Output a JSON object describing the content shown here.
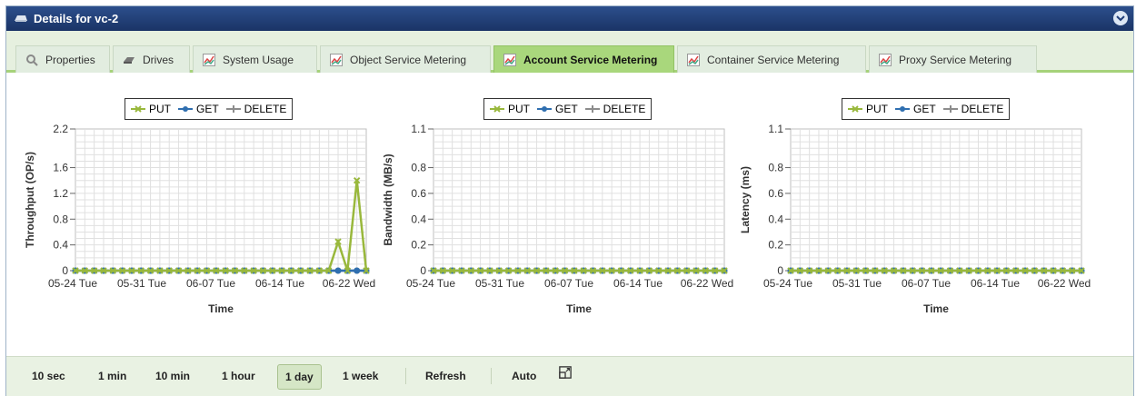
{
  "window": {
    "title": "Details for vc-2"
  },
  "tabs": [
    {
      "label": "Properties",
      "icon": "magnifier-icon"
    },
    {
      "label": "Drives",
      "icon": "drive-icon"
    },
    {
      "label": "System Usage",
      "icon": "chart-icon"
    },
    {
      "label": "Object Service Metering",
      "icon": "chart-icon"
    },
    {
      "label": "Account Service Metering",
      "icon": "chart-icon",
      "active": true
    },
    {
      "label": "Container Service Metering",
      "icon": "chart-icon"
    },
    {
      "label": "Proxy Service Metering",
      "icon": "chart-icon"
    }
  ],
  "legend": {
    "put": "PUT",
    "get": "GET",
    "delete": "DELETE"
  },
  "colors": {
    "put": "#99b83c",
    "get": "#2f6fb0",
    "delete": "#8c8c8c",
    "active_tab": "#a9d77c",
    "title_bar": "#1f3c78"
  },
  "chart_data": [
    {
      "type": "line",
      "xlabel": "Time",
      "ylabel": "Throughput (OP/s)",
      "ylim": [
        0,
        2.2
      ],
      "yticks": [
        "0",
        "0.4",
        "0.8",
        "1.2",
        "1.6",
        "2.2"
      ],
      "xticks": [
        "05-24 Tue",
        "05-31 Tue",
        "06-07 Tue",
        "06-14 Tue",
        "06-22 Wed"
      ],
      "grid": true,
      "legend_position": "top",
      "series": [
        {
          "name": "PUT",
          "values": [
            0,
            0,
            0,
            0,
            0,
            0,
            0,
            0,
            0,
            0,
            0,
            0,
            0,
            0,
            0,
            0,
            0,
            0,
            0,
            0,
            0,
            0,
            0,
            0,
            0,
            0,
            0,
            0,
            0.45,
            0,
            1.4,
            0
          ]
        },
        {
          "name": "GET",
          "values": [
            0,
            0,
            0,
            0,
            0,
            0,
            0,
            0,
            0,
            0,
            0,
            0,
            0,
            0,
            0,
            0,
            0,
            0,
            0,
            0,
            0,
            0,
            0,
            0,
            0,
            0,
            0,
            0,
            0,
            0,
            0,
            0
          ]
        },
        {
          "name": "DELETE",
          "values": [
            0,
            0,
            0,
            0,
            0,
            0,
            0,
            0,
            0,
            0,
            0,
            0,
            0,
            0,
            0,
            0,
            0,
            0,
            0,
            0,
            0,
            0,
            0,
            0,
            0,
            0,
            0,
            0,
            0,
            0,
            0,
            0
          ]
        }
      ]
    },
    {
      "type": "line",
      "xlabel": "Time",
      "ylabel": "Bandwidth (MB/s)",
      "ylim": [
        0,
        1.1
      ],
      "yticks": [
        "0",
        "0.2",
        "0.4",
        "0.6",
        "0.8",
        "1.1"
      ],
      "xticks": [
        "05-24 Tue",
        "05-31 Tue",
        "06-07 Tue",
        "06-14 Tue",
        "06-22 Wed"
      ],
      "grid": true,
      "legend_position": "top",
      "series": [
        {
          "name": "PUT",
          "values": [
            0,
            0,
            0,
            0,
            0,
            0,
            0,
            0,
            0,
            0,
            0,
            0,
            0,
            0,
            0,
            0,
            0,
            0,
            0,
            0,
            0,
            0,
            0,
            0,
            0,
            0,
            0,
            0,
            0,
            0,
            0,
            0
          ]
        },
        {
          "name": "GET",
          "values": [
            0,
            0,
            0,
            0,
            0,
            0,
            0,
            0,
            0,
            0,
            0,
            0,
            0,
            0,
            0,
            0,
            0,
            0,
            0,
            0,
            0,
            0,
            0,
            0,
            0,
            0,
            0,
            0,
            0,
            0,
            0,
            0
          ]
        },
        {
          "name": "DELETE",
          "values": [
            0,
            0,
            0,
            0,
            0,
            0,
            0,
            0,
            0,
            0,
            0,
            0,
            0,
            0,
            0,
            0,
            0,
            0,
            0,
            0,
            0,
            0,
            0,
            0,
            0,
            0,
            0,
            0,
            0,
            0,
            0,
            0
          ]
        }
      ]
    },
    {
      "type": "line",
      "xlabel": "Time",
      "ylabel": "Latency (ms)",
      "ylim": [
        0,
        1.1
      ],
      "yticks": [
        "0",
        "0.2",
        "0.4",
        "0.6",
        "0.8",
        "1.1"
      ],
      "xticks": [
        "05-24 Tue",
        "05-31 Tue",
        "06-07 Tue",
        "06-14 Tue",
        "06-22 Wed"
      ],
      "grid": true,
      "legend_position": "top",
      "series": [
        {
          "name": "PUT",
          "values": [
            0,
            0,
            0,
            0,
            0,
            0,
            0,
            0,
            0,
            0,
            0,
            0,
            0,
            0,
            0,
            0,
            0,
            0,
            0,
            0,
            0,
            0,
            0,
            0,
            0,
            0,
            0,
            0,
            0,
            0,
            0,
            0
          ]
        },
        {
          "name": "GET",
          "values": [
            0,
            0,
            0,
            0,
            0,
            0,
            0,
            0,
            0,
            0,
            0,
            0,
            0,
            0,
            0,
            0,
            0,
            0,
            0,
            0,
            0,
            0,
            0,
            0,
            0,
            0,
            0,
            0,
            0,
            0,
            0,
            0
          ]
        },
        {
          "name": "DELETE",
          "values": [
            0,
            0,
            0,
            0,
            0,
            0,
            0,
            0,
            0,
            0,
            0,
            0,
            0,
            0,
            0,
            0,
            0,
            0,
            0,
            0,
            0,
            0,
            0,
            0,
            0,
            0,
            0,
            0,
            0,
            0,
            0,
            0
          ]
        }
      ]
    }
  ],
  "footer": {
    "ranges": [
      "10 sec",
      "1 min",
      "10 min",
      "1 hour",
      "1 day",
      "1 week"
    ],
    "active_range": "1 day",
    "refresh_label": "Refresh",
    "auto_label": "Auto"
  }
}
